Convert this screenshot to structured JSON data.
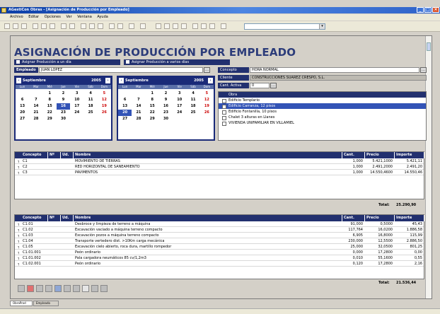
{
  "window": {
    "title": "AGestiCon Obras - [Asignación de Producción por Empleado]",
    "menus": [
      "Archivo",
      "Editar",
      "Opciones",
      "Ver",
      "Ventana",
      "Ayuda"
    ]
  },
  "page": {
    "heading": "ASIGNACIÓN DE PRODUCCIÓN POR EMPLEADO",
    "option_one_day": "Asignar Producción a un día",
    "option_many_days": "Asignar Producción a varios días"
  },
  "employee": {
    "label": "Empleado",
    "value": "JUAN LOPEZ"
  },
  "right_panel": {
    "concept_label": "Concepto",
    "concept_value": "HORA NORMAL",
    "client_label": "Cliente",
    "client_value": "CONSTRUCCIONES SUAREZ CRESPO, S.L.",
    "active_label": "Cant. Activa",
    "active_value": "0"
  },
  "calendars": [
    {
      "month": "Septiembre",
      "year": "2005",
      "weekdays": [
        "Lun",
        "Mar",
        "Mié",
        "Jue",
        "Vie",
        "Sáb",
        "Dom"
      ],
      "days": [
        "",
        "",
        "1",
        "2",
        "3",
        "4",
        "5",
        "6",
        "7",
        "8",
        "9",
        "10",
        "11",
        "12",
        "13",
        "14",
        "15",
        "16",
        "17",
        "18",
        "19",
        "20",
        "21",
        "22",
        "23",
        "24",
        "25",
        "26",
        "27",
        "28",
        "29",
        "30",
        "",
        "",
        "",
        ""
      ],
      "selected": "16"
    },
    {
      "month": "Septiembre",
      "year": "2005",
      "weekdays": [
        "Lun",
        "Mar",
        "Mié",
        "Jue",
        "Vie",
        "Sáb",
        "Dom"
      ],
      "days": [
        "",
        "",
        "1",
        "2",
        "3",
        "4",
        "5",
        "6",
        "7",
        "8",
        "9",
        "10",
        "11",
        "12",
        "13",
        "14",
        "15",
        "16",
        "17",
        "18",
        "19",
        "20",
        "21",
        "22",
        "23",
        "24",
        "25",
        "26",
        "27",
        "28",
        "29",
        "30",
        "",
        "",
        "",
        ""
      ],
      "selected": "20"
    }
  ],
  "obras": {
    "header": "Obra",
    "items": [
      "Edificio Templario",
      "Edificio Carranza, 12 pisos",
      "Edificio Fontanilla, 10 pisos",
      "Chalet 3 alturas en Llanes",
      "VIVIENDA UNIFAMILIAR EN VILLAMIEL"
    ],
    "selected_index": 1
  },
  "upper_table": {
    "columns": [
      "Concepto",
      "Nº",
      "Ud.",
      "Nombre",
      "Cant.",
      "Precio",
      "Importe"
    ],
    "rows": [
      [
        "C1",
        "",
        "",
        "MOVIMIENTO DE TIERRAS",
        "1,000",
        "5.421,1000",
        "5.421,11"
      ],
      [
        "C2",
        "",
        "",
        "RED HORIZONTAL DE SANEAMIENTO",
        "1,000",
        "2.491,2000",
        "2.491,20"
      ],
      [
        "C3",
        "",
        "",
        "PAVIMENTOS",
        "1,000",
        "14.550,4600",
        "14.550,46"
      ]
    ],
    "total_label": "Total:",
    "total_value": "25.290,90"
  },
  "lower_table": {
    "columns": [
      "Concepto",
      "Nº",
      "Ud.",
      "Nombre",
      "Cant.",
      "Precio",
      "Importe"
    ],
    "rows": [
      [
        "C1.01",
        "",
        "",
        "Desbroce y limpieza de terreno a máquina",
        "91,000",
        "0,5000",
        "45,43"
      ],
      [
        "C1.02",
        "",
        "",
        "Excavación vaciado a máquina terreno compacto",
        "117,764",
        "16,0200",
        "1.886,58"
      ],
      [
        "C1.03",
        "",
        "",
        "Excavación pozos a máquina terreno compacto",
        "6,905",
        "16,8000",
        "115,99"
      ],
      [
        "C1.04",
        "",
        "",
        "Transporte vertedero dist. >10Km carga mecánica",
        "230,000",
        "12,5500",
        "2.886,50"
      ],
      [
        "C1.05",
        "",
        "",
        "Excavación cielo abierto, roca dura, martillo rompedor",
        "25,000",
        "32,0500",
        "801,25"
      ],
      [
        "C1.01.001",
        "",
        "",
        "Peón ordinario",
        "0,000",
        "17,2800",
        "0,00"
      ],
      [
        "C1.01.002",
        "",
        "",
        "Pala cargadora neumáticos 85 cv/1,2m3",
        "0,010",
        "55,1600",
        "0,55"
      ],
      [
        "C1.02.001",
        "",
        "",
        "Peón ordinario",
        "0,120",
        "17,2800",
        "2,16"
      ]
    ],
    "total_label": "Total:",
    "total_value": "21.536,44"
  },
  "tabs": [
    "ObraProd",
    "Empleado"
  ]
}
